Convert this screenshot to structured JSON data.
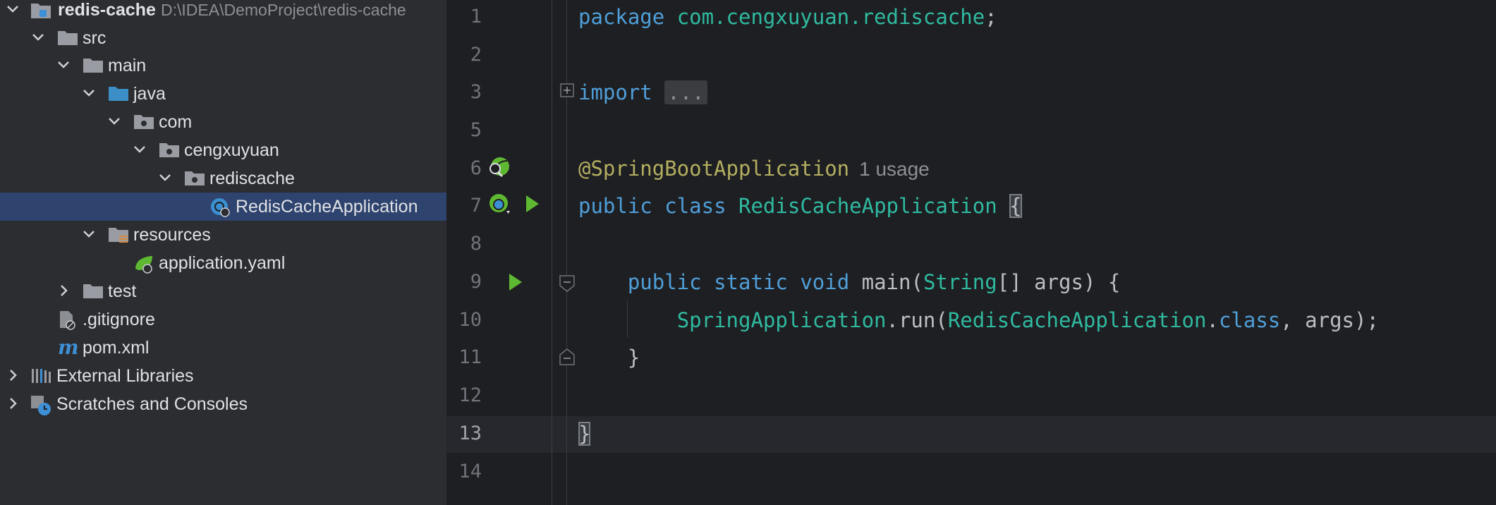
{
  "project_tree": {
    "root": {
      "name": "redis-cache",
      "path": "D:\\IDEA\\DemoProject\\redis-cache"
    },
    "items": [
      {
        "label": "src"
      },
      {
        "label": "main"
      },
      {
        "label": "java"
      },
      {
        "label": "com"
      },
      {
        "label": "cengxuyuan"
      },
      {
        "label": "rediscache"
      },
      {
        "label": "RedisCacheApplication"
      },
      {
        "label": "resources"
      },
      {
        "label": "application.yaml"
      },
      {
        "label": "test"
      },
      {
        "label": ".gitignore"
      },
      {
        "label": "pom.xml"
      },
      {
        "label": "External Libraries"
      },
      {
        "label": "Scratches and Consoles"
      }
    ],
    "selected": "RedisCacheApplication"
  },
  "editor": {
    "line_numbers": [
      "1",
      "2",
      "3",
      "5",
      "6",
      "7",
      "8",
      "9",
      "10",
      "11",
      "12",
      "13",
      "14"
    ],
    "current_line": "13",
    "code": {
      "l1_kw": "package",
      "l1_pkg": "com.cengxuyuan.rediscache",
      "l1_end": ";",
      "l3_kw": "import",
      "l3_fold": "...",
      "l6_anno": "@SpringBootApplication",
      "l6_hint": "1 usage",
      "l7_kw1": "public",
      "l7_kw2": "class",
      "l7_cls": "RedisCacheApplication",
      "l7_brace": "{",
      "l9_kw1": "public",
      "l9_kw2": "static",
      "l9_kw3": "void",
      "l9_fn": "main",
      "l9_open": "(",
      "l9_type": "String",
      "l9_rest": "[] args) {",
      "l10_cls": "SpringApplication",
      "l10_call": ".run(",
      "l10_arg": "RedisCacheApplication",
      "l10_dot": ".",
      "l10_kw": "class",
      "l10_end": ", args);",
      "l11": "}",
      "l13": "}"
    }
  },
  "colors": {
    "tree_bg": "#2b2d30",
    "editor_bg": "#1e1f22",
    "selection": "#2e436e",
    "keyword": "#4f9fd9",
    "class": "#2fbaa0",
    "annotation": "#b3ae60",
    "run_green": "#5fb832"
  }
}
